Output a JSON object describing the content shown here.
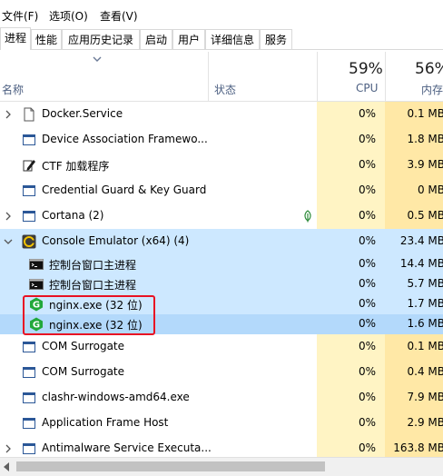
{
  "menu": [
    "文件(F)",
    "选项(O)",
    "查看(V)"
  ],
  "tabs": [
    "进程",
    "性能",
    "应用历史记录",
    "启动",
    "用户",
    "详细信息",
    "服务"
  ],
  "columns": {
    "name": "名称",
    "status": "状态",
    "cpu_label": "CPU",
    "cpu_pct": "59%",
    "mem_label": "内存",
    "mem_pct": "56%"
  },
  "rows": [
    {
      "name": "Docker.Service",
      "cpu": "0%",
      "mem": "0.1 MB",
      "icon": "blank-document-icon",
      "expand": true
    },
    {
      "name": "Device Association Framewo...",
      "cpu": "0%",
      "mem": "1.8 MB",
      "icon": "service-window-icon",
      "expand": false
    },
    {
      "name": "CTF 加载程序",
      "cpu": "0%",
      "mem": "3.9 MB",
      "icon": "pen-notepad-icon",
      "expand": false
    },
    {
      "name": "Credential Guard & Key Guard",
      "cpu": "0%",
      "mem": "0 MB",
      "icon": "service-window-icon",
      "expand": false
    },
    {
      "name": "Cortana (2)",
      "cpu": "0%",
      "mem": "0.5 MB",
      "icon": "service-window-icon",
      "expand": true,
      "status_icon": "leaf-suspended-icon"
    },
    {
      "name": "Console Emulator (x64) (4)",
      "cpu": "0%",
      "mem": "23.4 MB",
      "icon": "conemu-icon",
      "expand": true,
      "expanded": true,
      "selected": true
    },
    {
      "name": "控制台窗口主进程",
      "cpu": "0%",
      "mem": "14.4 MB",
      "icon": "console-icon",
      "child": true,
      "selected": true
    },
    {
      "name": "控制台窗口主进程",
      "cpu": "0%",
      "mem": "5.7 MB",
      "icon": "console-icon",
      "child": true,
      "selected": true
    },
    {
      "name": "nginx.exe (32 位)",
      "cpu": "0%",
      "mem": "1.7 MB",
      "icon": "nginx-icon",
      "child": true,
      "selected": true
    },
    {
      "name": "nginx.exe (32 位)",
      "cpu": "0%",
      "mem": "1.6 MB",
      "icon": "nginx-icon",
      "child": true,
      "selected": true,
      "focused": true
    },
    {
      "name": "COM Surrogate",
      "cpu": "0%",
      "mem": "0.1 MB",
      "icon": "service-window-icon",
      "expand": false
    },
    {
      "name": "COM Surrogate",
      "cpu": "0%",
      "mem": "0.4 MB",
      "icon": "service-window-icon",
      "expand": false
    },
    {
      "name": "clashr-windows-amd64.exe",
      "cpu": "0%",
      "mem": "7.9 MB",
      "icon": "service-window-icon",
      "expand": false
    },
    {
      "name": "Application Frame Host",
      "cpu": "0%",
      "mem": "2.9 MB",
      "icon": "service-window-icon",
      "expand": false
    },
    {
      "name": "Antimalware Service Executa...",
      "cpu": "0%",
      "mem": "163.8 MB",
      "icon": "service-window-icon",
      "expand": true
    }
  ],
  "colors": {
    "cpu_bg": "#fff4c4",
    "mem_bg": "#ffe8a6",
    "selection": "#cde8ff",
    "highlight_box": "#e81123"
  }
}
